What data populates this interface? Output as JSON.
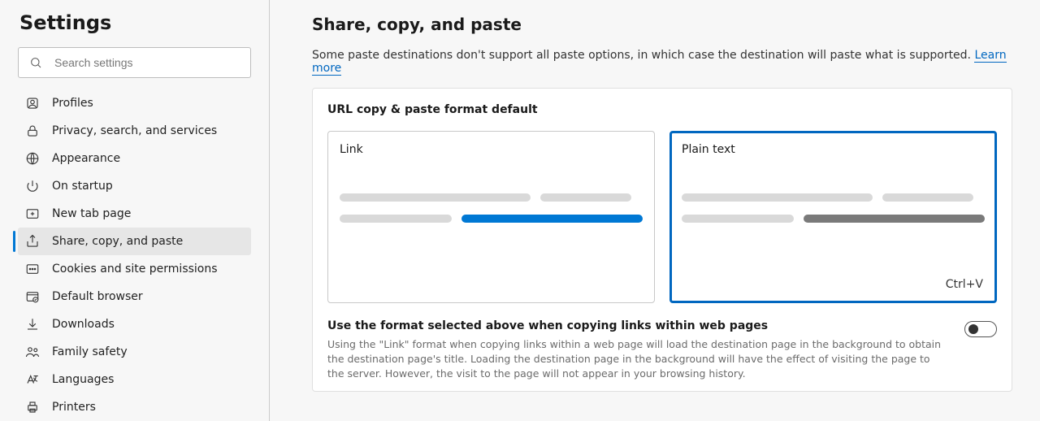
{
  "sidebar": {
    "title": "Settings",
    "search_placeholder": "Search settings",
    "items": [
      {
        "label": "Profiles"
      },
      {
        "label": "Privacy, search, and services"
      },
      {
        "label": "Appearance"
      },
      {
        "label": "On startup"
      },
      {
        "label": "New tab page"
      },
      {
        "label": "Share, copy, and paste"
      },
      {
        "label": "Cookies and site permissions"
      },
      {
        "label": "Default browser"
      },
      {
        "label": "Downloads"
      },
      {
        "label": "Family safety"
      },
      {
        "label": "Languages"
      },
      {
        "label": "Printers"
      }
    ]
  },
  "main": {
    "title": "Share, copy, and paste",
    "description": "Some paste destinations don't support all paste options, in which case the destination will paste what is supported. ",
    "learn_more": "Learn more",
    "section_heading": "URL copy & paste format default",
    "options": {
      "link": {
        "title": "Link"
      },
      "plain": {
        "title": "Plain text",
        "shortcut": "Ctrl+V"
      }
    },
    "pref": {
      "title": "Use the format selected above when copying links within web pages",
      "desc": "Using the \"Link\" format when copying links within a web page will load the destination page in the background to obtain the destination page's title. Loading the destination page in the background will have the effect of visiting the page to the server. However, the visit to the page will not appear in your browsing history.",
      "enabled": false
    }
  }
}
